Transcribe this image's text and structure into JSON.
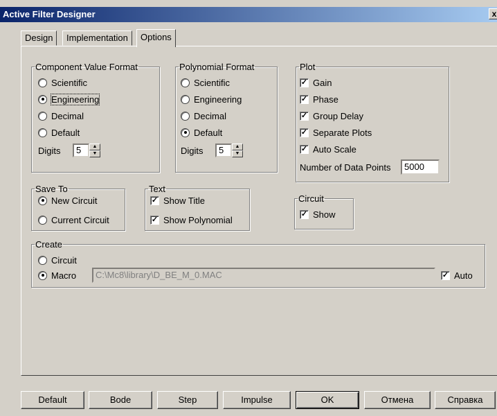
{
  "window": {
    "title": "Active Filter Designer",
    "close_glyph": "x"
  },
  "tabs": [
    {
      "label": "Design",
      "active": false
    },
    {
      "label": "Implementation",
      "active": false
    },
    {
      "label": "Options",
      "active": true
    }
  ],
  "component_value_format": {
    "legend": "Component Value Format",
    "options": [
      "Scientific",
      "Engineering",
      "Decimal",
      "Default"
    ],
    "selected": "Engineering",
    "digits_label": "Digits",
    "digits_value": "5"
  },
  "polynomial_format": {
    "legend": "Polynomial Format",
    "options": [
      "Scientific",
      "Engineering",
      "Decimal",
      "Default"
    ],
    "selected": "Default",
    "digits_label": "Digits",
    "digits_value": "5"
  },
  "plot": {
    "legend": "Plot",
    "checks": [
      {
        "label": "Gain",
        "checked": true
      },
      {
        "label": "Phase",
        "checked": true
      },
      {
        "label": "Group Delay",
        "checked": true
      },
      {
        "label": "Separate Plots",
        "checked": true
      },
      {
        "label": "Auto Scale",
        "checked": true
      }
    ],
    "points_label": "Number of Data Points",
    "points_value": "5000"
  },
  "save_to": {
    "legend": "Save To",
    "options": [
      "New Circuit",
      "Current Circuit"
    ],
    "selected": "New Circuit"
  },
  "text": {
    "legend": "Text",
    "checks": [
      {
        "label": "Show Title",
        "checked": true
      },
      {
        "label": "Show Polynomial",
        "checked": true
      }
    ]
  },
  "circuit": {
    "legend": "Circuit",
    "checks": [
      {
        "label": "Show",
        "checked": true
      }
    ]
  },
  "create": {
    "legend": "Create",
    "options": [
      "Circuit",
      "Macro"
    ],
    "selected": "Macro",
    "path_value": "C:\\Mc8\\library\\D_BE_M_0.MAC",
    "auto_label": "Auto",
    "auto_checked": true
  },
  "buttons": {
    "default": "Default",
    "bode": "Bode",
    "step": "Step",
    "impulse": "Impulse",
    "ok": "OK",
    "cancel": "Отмена",
    "help": "Справка"
  }
}
